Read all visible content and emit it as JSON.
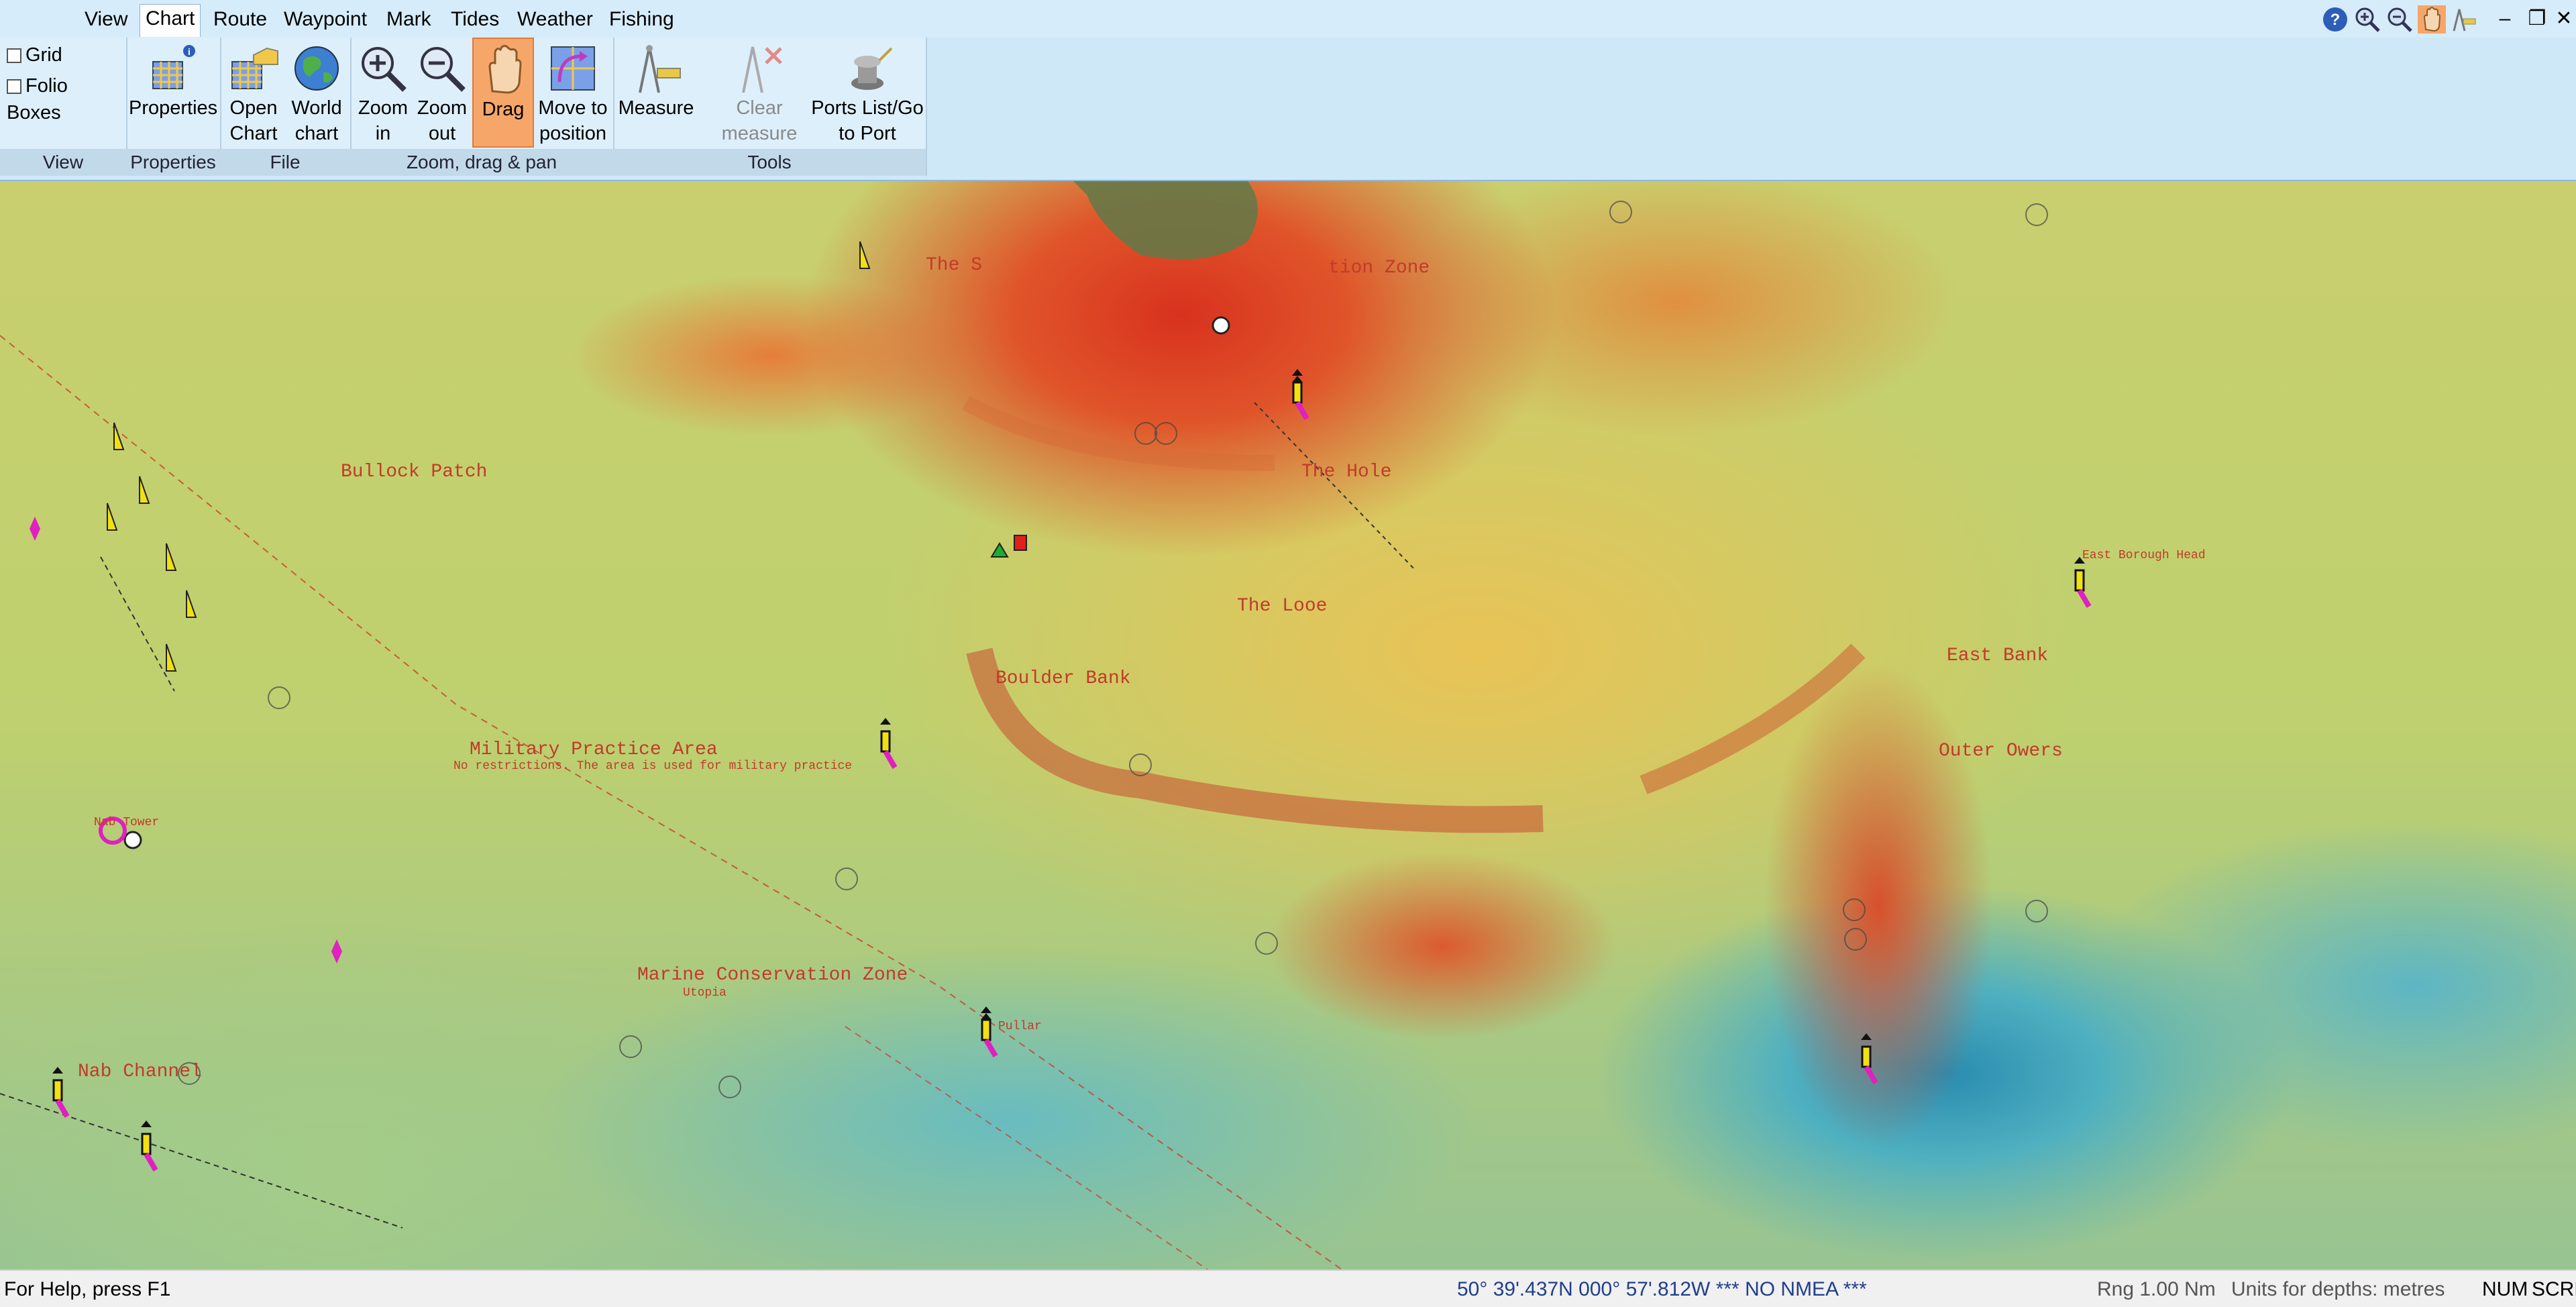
{
  "menubar": {
    "items": [
      {
        "label": "View"
      },
      {
        "label": "Chart",
        "active": true
      },
      {
        "label": "Route"
      },
      {
        "label": "Waypoint"
      },
      {
        "label": "Mark"
      },
      {
        "label": "Tides"
      },
      {
        "label": "Weather"
      },
      {
        "label": "Fishing"
      }
    ],
    "right_icons": [
      "help-icon",
      "zoom-in-icon",
      "zoom-out-icon",
      "drag-hand-icon",
      "measure-icon"
    ],
    "window_controls": {
      "minimize": "–",
      "restore": "❐",
      "close": "✕"
    }
  },
  "ribbon": {
    "view_group": {
      "label": "View",
      "checkboxes": [
        {
          "label": "Grid",
          "checked": false
        },
        {
          "label": "Folio Boxes",
          "checked": false
        }
      ]
    },
    "properties_group": {
      "label": "Properties",
      "buttons": [
        {
          "label": "Properties"
        }
      ]
    },
    "file_group": {
      "label": "File",
      "buttons": [
        {
          "label": "Open\nChart"
        },
        {
          "label": "World\nchart"
        }
      ]
    },
    "zoom_group": {
      "label": "Zoom,  drag & pan",
      "buttons": [
        {
          "label": "Zoom\nin"
        },
        {
          "label": "Zoom\nout"
        },
        {
          "label": "Drag",
          "pressed": true
        },
        {
          "label": "Move to\nposition"
        }
      ]
    },
    "tools_group": {
      "label": "Tools",
      "buttons": [
        {
          "label": "Measure"
        },
        {
          "label": "Clear\nmeasure lines",
          "disabled": true
        },
        {
          "label": "Ports List/Go\nto Port"
        }
      ]
    }
  },
  "map": {
    "labels": {
      "bullock_patch": "Bullock Patch",
      "the_hole": "The Hole",
      "the_looe": "The Looe",
      "boulder_bank": "Boulder Bank",
      "east_bank": "East Bank",
      "outer_owers": "Outer Owers",
      "military_practice_area": "Military Practice Area",
      "military_note": "No restrictions. The area is used for military practice",
      "marine_conservation_zone": "Marine Conservation Zone",
      "utopia": "Utopia",
      "nab_channel": "Nab Channel",
      "nab_tower": "Nab Tower",
      "the_s": "The S",
      "owers_zone": "tion Zone",
      "pullar": "Pullar",
      "east_borough_head": "East Borough Head"
    },
    "colors": {
      "shallow": "#d8321e",
      "mid": "#e9c356",
      "deep": "#2a8cb0",
      "label": "#c23a2a",
      "buoy_yellow": "#f2e010",
      "buoy_magenta": "#e020c0"
    }
  },
  "status": {
    "help": "For Help, press F1",
    "position": "50° 39'.437N  000° 57'.812W  *** NO NMEA ***",
    "range": "Rng 1.00 Nm",
    "units": "Units for depths: metres",
    "num": "NUM",
    "scrl": "SCRL"
  }
}
